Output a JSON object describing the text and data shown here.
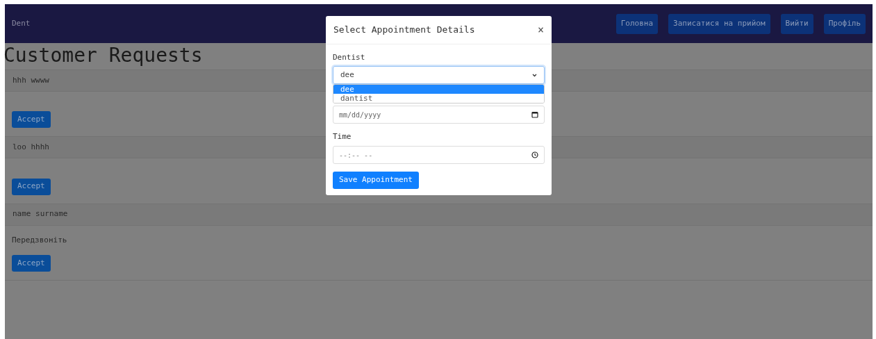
{
  "navbar": {
    "brand": "Dent",
    "links": [
      "Головна",
      "Записатися на прийом",
      "Вийти",
      "Профіль"
    ]
  },
  "heading": "Customer Requests",
  "requests": [
    {
      "name": "hhh wwww",
      "button": "Accept"
    },
    {
      "name": "loo hhhh",
      "button": "Accept"
    },
    {
      "name": "name surname",
      "message": "Передзвоніть",
      "button": "Accept"
    }
  ],
  "modal": {
    "title": "Select Appointment Details",
    "close": "×",
    "dentist": {
      "label": "Dentist",
      "value": "dee",
      "options": [
        {
          "label": "dee",
          "selected": true
        },
        {
          "label": "dantist",
          "selected": false
        }
      ]
    },
    "date": {
      "placeholder": "mm/dd/yyyy"
    },
    "time": {
      "label": "Time",
      "placeholder": "--:-- --"
    },
    "save_button": "Save Appointment"
  }
}
